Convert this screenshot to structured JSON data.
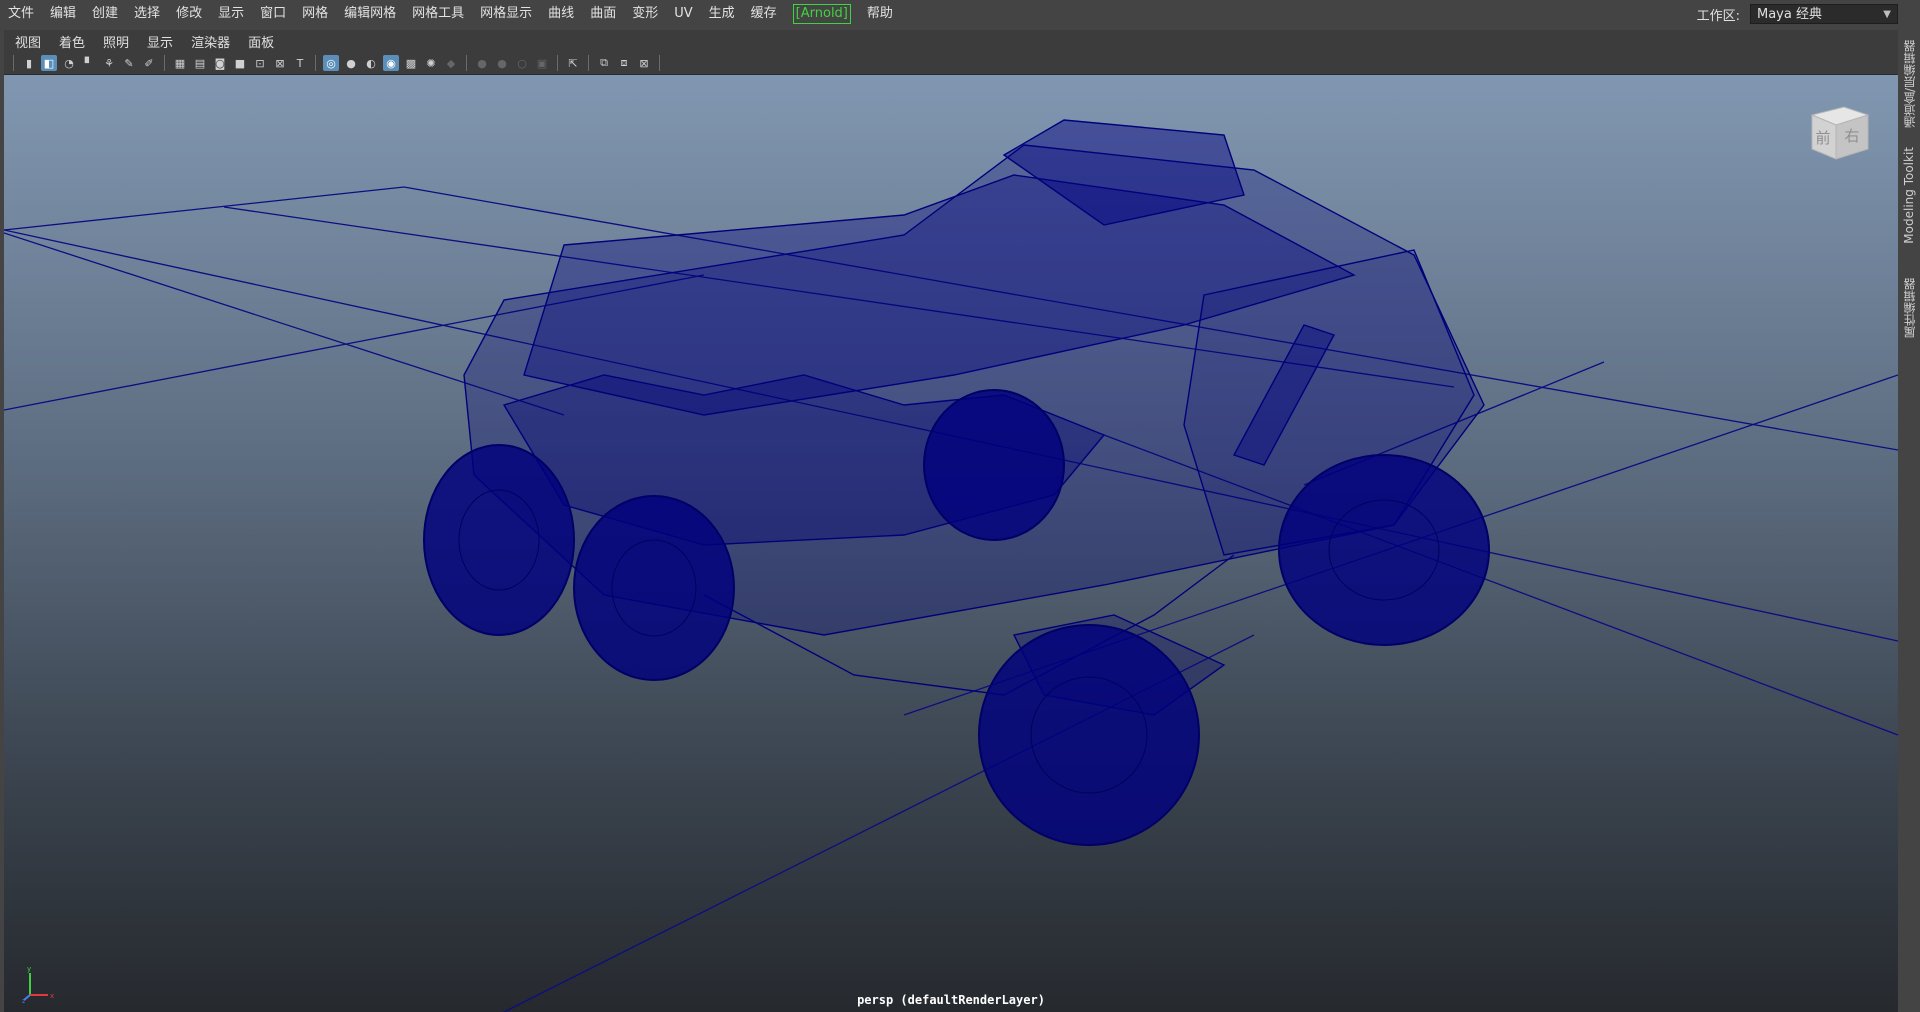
{
  "menubar": {
    "items": [
      "文件",
      "编辑",
      "创建",
      "选择",
      "修改",
      "显示",
      "窗口",
      "网格",
      "编辑网格",
      "网格工具",
      "网格显示",
      "曲线",
      "曲面",
      "变形",
      "UV",
      "生成",
      "缓存",
      "[Arnold]",
      "帮助"
    ],
    "workspace_label": "工作区:",
    "workspace_value": "Maya 经典"
  },
  "panel_menu": [
    "视图",
    "着色",
    "照明",
    "显示",
    "渲染器",
    "面板"
  ],
  "toolbar_icons": [
    "camera-icon",
    "camera-attr-icon",
    "bookmark-icon",
    "image-plane-icon",
    "2d-pan-icon",
    "grease-pencil-icon",
    "grid-icon",
    "film-gate-icon",
    "resolution-gate-icon",
    "gate-mask-icon",
    "field-chart-icon",
    "safe-action-icon",
    "safe-title-icon",
    "wireframe-icon",
    "smooth-shade-icon",
    "default-material-icon",
    "xray-icon",
    "textured-icon",
    "use-all-lights-icon",
    "shadows-icon",
    "screen-space-ao-icon",
    "motion-blur-icon",
    "multisample-aa-icon",
    "depth-of-field-icon",
    "isolate-select-icon",
    "xray-joints-icon",
    "xray-active-icon",
    "backface-cull-icon"
  ],
  "viewport": {
    "camera_label": "persp (defaultRenderLayer)",
    "viewcube_front": "前",
    "viewcube_right": "右",
    "axis_x": "x",
    "axis_y": "y",
    "axis_z": "z",
    "wire_color": "#000080",
    "grid_color": "#0d0d80"
  },
  "sidebar": {
    "tabs": [
      "通道盒/层编辑器",
      "Modeling Toolkit",
      "属性编辑器"
    ]
  }
}
